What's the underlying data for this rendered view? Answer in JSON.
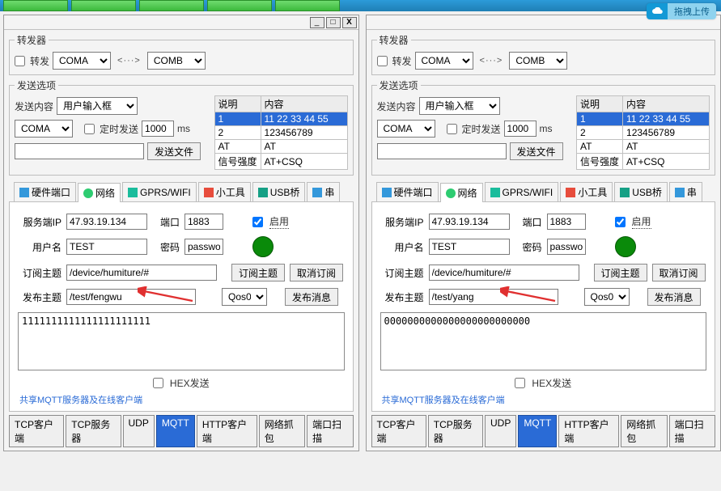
{
  "upload_badge": "拖拽上传",
  "forwarder": {
    "legend": "转发器",
    "forward_label": "转发",
    "port_a": "COMA",
    "port_b": "COMB",
    "arrow": "<···>"
  },
  "send": {
    "legend": "发送选项",
    "content_label": "发送内容",
    "content_select": "用户输入框",
    "port_select": "COMA",
    "timed_label": "定时发送",
    "interval": "1000",
    "unit": "ms",
    "send_file_btn": "发送文件",
    "cols": {
      "c1": "说明",
      "c2": "内容"
    },
    "rows": [
      {
        "desc": "1",
        "val": "11 22 33 44 55"
      },
      {
        "desc": "2",
        "val": "123456789"
      },
      {
        "desc": "AT",
        "val": "AT"
      },
      {
        "desc": "信号强度",
        "val": "AT+CSQ"
      }
    ]
  },
  "tabs": {
    "hw": "硬件端口",
    "net": "网络",
    "gprs": "GPRS/WIFI",
    "tool": "小工具",
    "usb": "USB桥",
    "serial": "串"
  },
  "net": {
    "server_ip_lbl": "服务端IP",
    "port_lbl": "端口",
    "enable_lbl": "启用",
    "user_lbl": "用户名",
    "pass_lbl": "密码",
    "server_ip": "47.93.19.134",
    "port": "1883",
    "user": "TEST",
    "pass": "passwo",
    "sub_topic_lbl": "订阅主题",
    "sub_topic": "/device/humiture/#",
    "sub_btn": "订阅主题",
    "unsub_btn": "取消订阅",
    "pub_topic_lbl": "发布主题",
    "qos": "Qos0",
    "pub_btn": "发布消息",
    "hex_lbl": "HEX发送",
    "mqtt_note": "共享MQTT服务器及在线客户端"
  },
  "bottom_tabs": {
    "tcp_client": "TCP客户端",
    "tcp_server": "TCP服务器",
    "udp": "UDP",
    "mqtt": "MQTT",
    "http_client": "HTTP客户端",
    "sniff": "网络抓包",
    "portscan": "端口扫描"
  },
  "panels": [
    {
      "show_winbtns": true,
      "pub_topic": "/test/fengwu",
      "msg": "1111111111111111111111"
    },
    {
      "show_winbtns": false,
      "pub_topic": "/test/yang",
      "msg": "0000000000000000000000000"
    }
  ]
}
